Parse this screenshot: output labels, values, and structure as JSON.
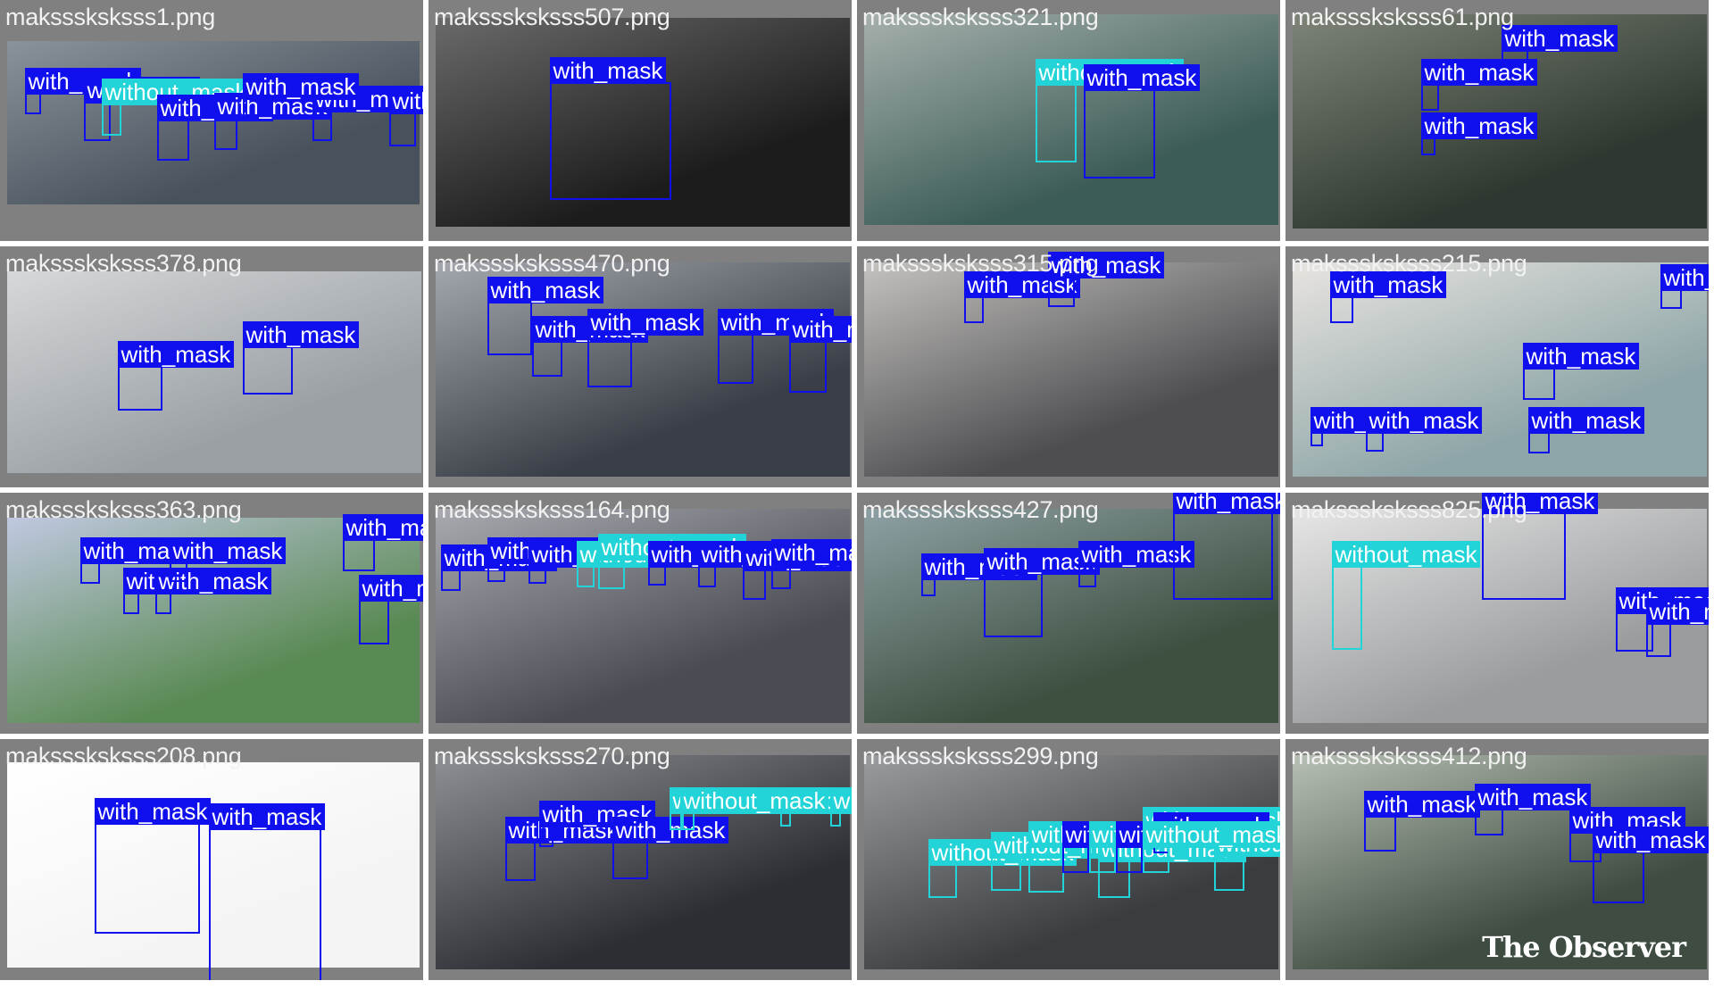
{
  "colors": {
    "with_mask": "#1010ee",
    "without_mask": "#22d4d8",
    "panel": "#808080",
    "divider": "#ffffff",
    "label_text": "#ffffff"
  },
  "labels": {
    "with_mask": "with_mask",
    "without_mask": "without_mask"
  },
  "cells": [
    {
      "filename": "maksssksksss1.png",
      "tone": [
        "#48525c",
        "#8a929a"
      ],
      "detections": [
        "with_mask",
        "with_mask",
        "without_mask",
        "with_mask",
        "with_mask",
        "with_mask",
        "with_mask",
        "with_mask"
      ]
    },
    {
      "filename": "maksssksksss507.png",
      "tone": [
        "#1c1c1c",
        "#6a6a6a"
      ],
      "detections": [
        "with_mask"
      ]
    },
    {
      "filename": "maksssksksss321.png",
      "tone": [
        "#3c5c58",
        "#a6b0ac"
      ],
      "detections": [
        "without_mask",
        "with_mask"
      ]
    },
    {
      "filename": "maksssksksss61.png",
      "tone": [
        "#2e3830",
        "#7e8478"
      ],
      "detections": [
        "with_mask",
        "with_mask",
        "with_mask"
      ]
    },
    {
      "filename": "maksssksksss378.png",
      "tone": [
        "#9aa0a4",
        "#d6d8da"
      ],
      "detections": [
        "with_mask",
        "with_mask"
      ]
    },
    {
      "filename": "maksssksksss470.png",
      "tone": [
        "#3a3e46",
        "#a4a8ae"
      ],
      "detections": [
        "with_mask",
        "with_mask",
        "with_mask",
        "with_mask",
        "with_mask"
      ]
    },
    {
      "filename": "maksssksksss315.png",
      "tone": [
        "#4e4e52",
        "#c4c2be"
      ],
      "detections": [
        "with_mask",
        "with_mask"
      ]
    },
    {
      "filename": "maksssksksss215.png",
      "tone": [
        "#8fa6a8",
        "#e8e4e0"
      ],
      "detections": [
        "with_mask",
        "with_mask",
        "with_mask",
        "with_mask",
        "with_mask",
        "with_mask"
      ]
    },
    {
      "filename": "maksssksksss363.png",
      "tone": [
        "#5a8a54",
        "#c0c8e0"
      ],
      "detections": [
        "with_mask",
        "with_mask",
        "with_mask",
        "with_mask",
        "with_mask",
        "with_mask"
      ]
    },
    {
      "filename": "maksssksksss164.png",
      "tone": [
        "#4a4c54",
        "#a8aab0"
      ],
      "detections": [
        "with_mask",
        "with_mask",
        "with_mask",
        "without_mask",
        "without_mask",
        "with_mask",
        "with_mask",
        "with_mask",
        "with_mask"
      ]
    },
    {
      "filename": "maksssksksss427.png",
      "tone": [
        "#3e5040",
        "#8ea0a4"
      ],
      "detections": [
        "with_mask",
        "with_mask",
        "with_mask",
        "with_mask"
      ]
    },
    {
      "filename": "maksssksksss825.png",
      "tone": [
        "#9a9c9e",
        "#e6e6e6"
      ],
      "detections": [
        "without_mask",
        "with_mask",
        "with_mask",
        "with_mask"
      ]
    },
    {
      "filename": "maksssksksss208.png",
      "tone": [
        "#f4f4f4",
        "#ffffff"
      ],
      "detections": [
        "with_mask",
        "with_mask"
      ]
    },
    {
      "filename": "maksssksksss270.png",
      "tone": [
        "#2c2e34",
        "#8e9094"
      ],
      "detections": [
        "with_mask",
        "with_mask",
        "with_mask",
        "without_mask",
        "without_mask",
        "without_mask",
        "without_mask"
      ]
    },
    {
      "filename": "maksssksksss299.png",
      "tone": [
        "#3a3c40",
        "#9a9ca0"
      ],
      "detections": [
        "without_mask",
        "without_mask",
        "without_mask",
        "without_mask",
        "without_mask",
        "without_mask",
        "with_mask",
        "with_mask",
        "without_mask",
        "with_mask",
        "without_mask"
      ]
    },
    {
      "filename": "maksssksksss412.png",
      "tone": [
        "#3e4c42",
        "#b8c0b4"
      ],
      "detections": [
        "with_mask",
        "with_mask",
        "with_mask",
        "with_mask"
      ],
      "watermark": "The Observer"
    }
  ]
}
